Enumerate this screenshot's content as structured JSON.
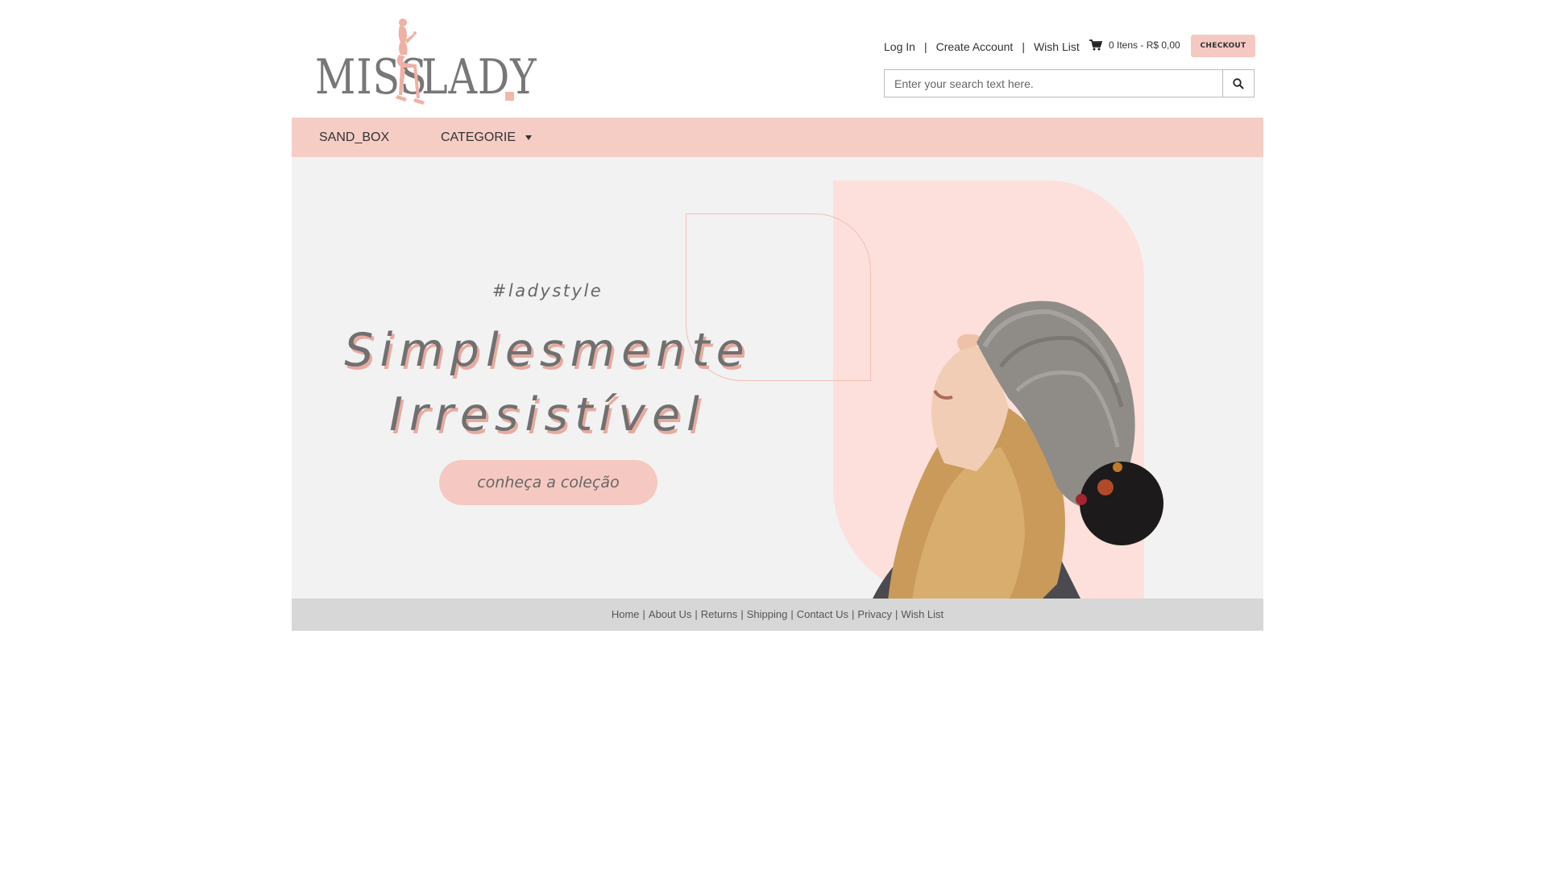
{
  "brand": {
    "logo_left": "MISS",
    "logo_right": "LADY"
  },
  "header": {
    "links": [
      "Log In",
      "Create Account",
      "Wish List"
    ],
    "cart_summary": "0 Itens - R$ 0,00",
    "checkout_label": "CHECKOUT",
    "search_placeholder": "Enter your search text here."
  },
  "nav": {
    "items": [
      {
        "label": "SAND_BOX"
      },
      {
        "label": "CATEGORIE"
      }
    ]
  },
  "banner": {
    "hashtag": "#ladystyle",
    "headline_line1": "Simplesmente",
    "headline_line2": "Irresistível",
    "cta_label": "conheça a coleção",
    "colors": {
      "accent": "#f5c9c1",
      "pink_shape": "#fde0db",
      "background": "#f2f2f2"
    }
  },
  "footer": {
    "links": [
      "Home",
      "About Us",
      "Returns",
      "Shipping",
      "Contact Us",
      "Privacy",
      "Wish List"
    ]
  },
  "icons": {
    "cart": "cart-icon",
    "search": "search-icon",
    "caret": "caret-down-icon"
  }
}
